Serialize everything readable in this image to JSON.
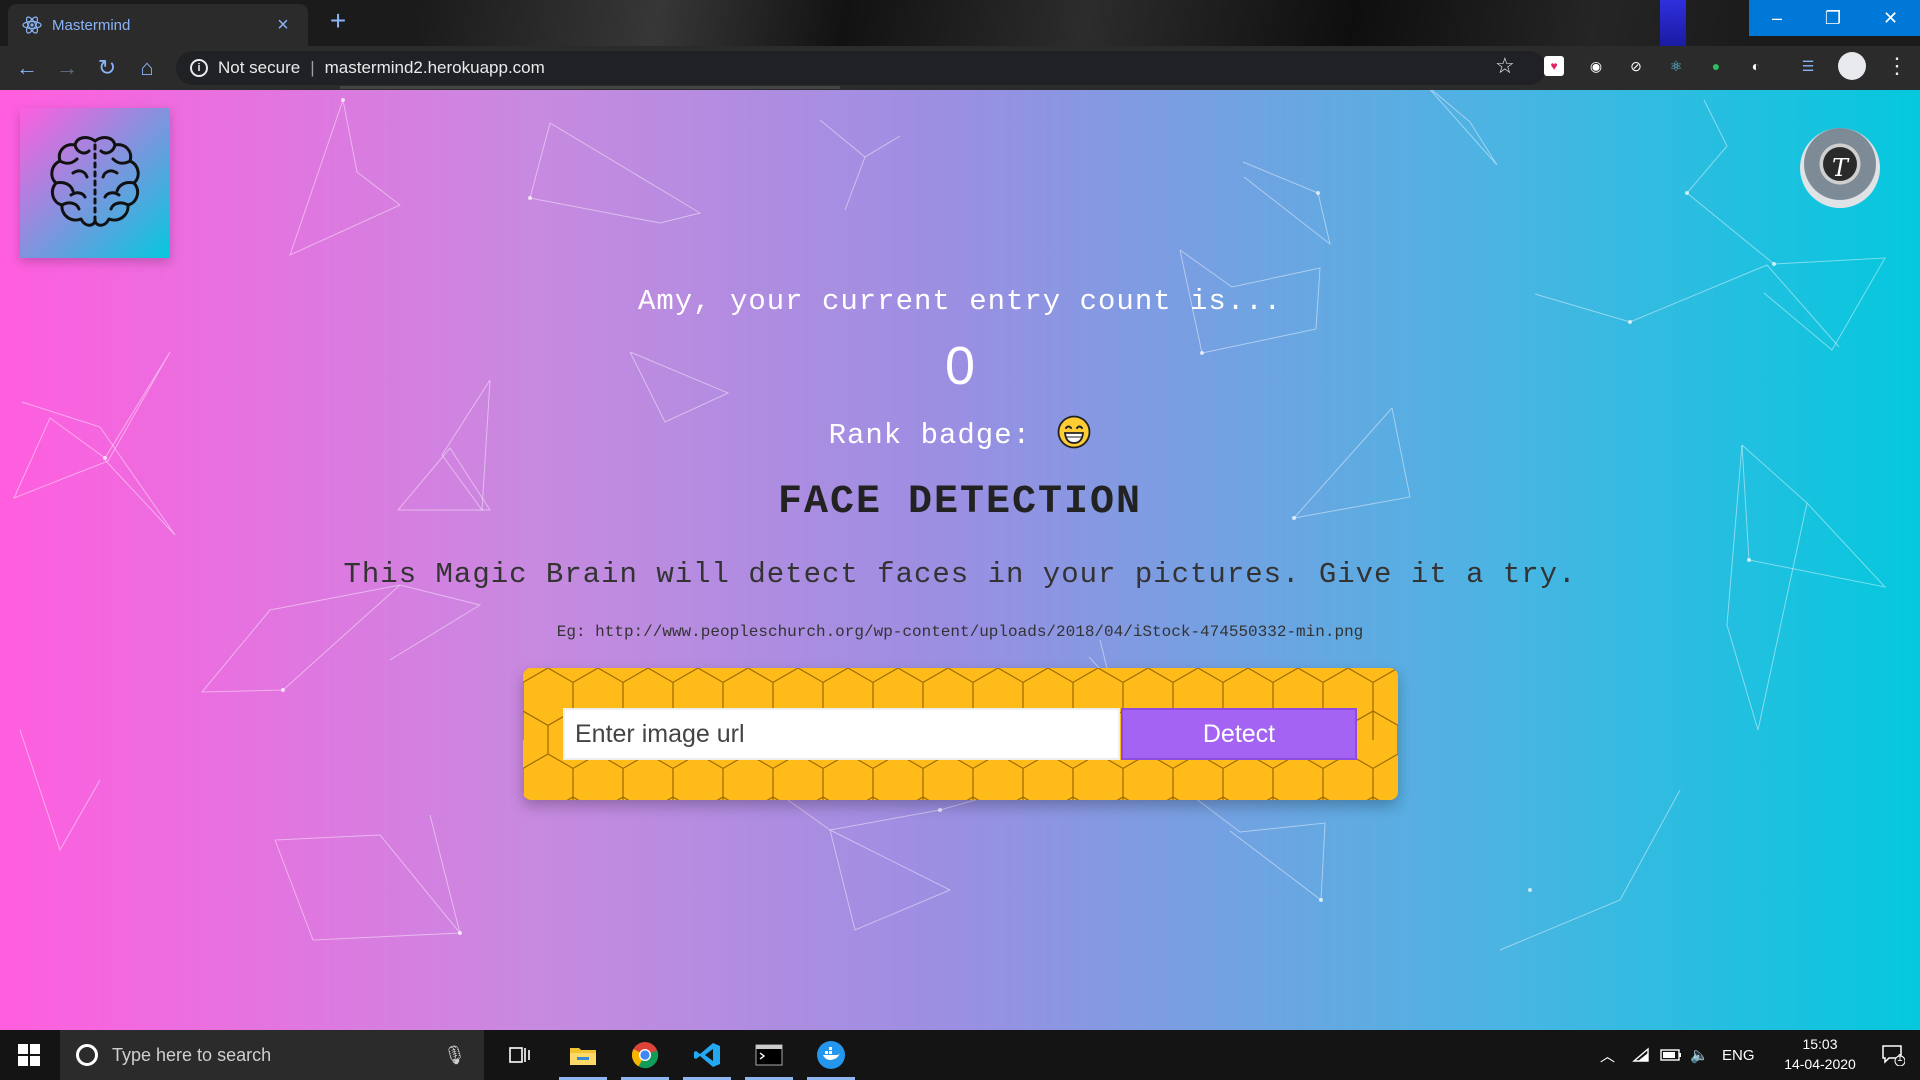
{
  "browser": {
    "tab_title": "Mastermind",
    "security_label": "Not secure",
    "url": "mastermind2.herokuapp.com"
  },
  "page": {
    "greeting": "Amy, your current entry count is...",
    "entry_count": "0",
    "rank_label": "Rank badge:",
    "rank_emoji": "grinning-face",
    "heading": "FACE DETECTION",
    "description": "This Magic Brain will detect faces in your pictures. Give it a try.",
    "example": "Eg: http://www.peopleschurch.org/wp-content/uploads/2018/04/iStock-474550332-min.png",
    "input_placeholder": "Enter image url",
    "input_value": "",
    "detect_label": "Detect",
    "avatar_initial": "T",
    "colors": {
      "gradient_left": "#ff5edf",
      "gradient_right": "#04c8de",
      "panel": "#ffbb1a",
      "button": "#a463f2"
    }
  },
  "taskbar": {
    "search_placeholder": "Type here to search",
    "language": "ENG",
    "time": "15:03",
    "date": "14-04-2020",
    "notification_count": "1"
  }
}
